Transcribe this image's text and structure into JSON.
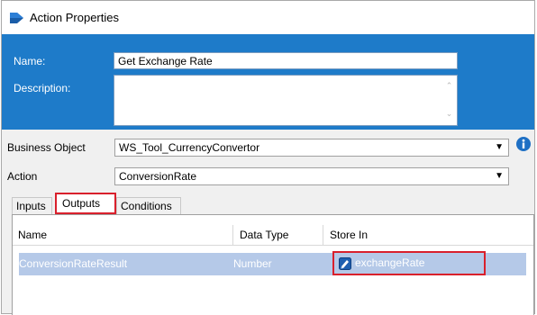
{
  "window": {
    "title": "Action Properties"
  },
  "form": {
    "name_label": "Name:",
    "name_value": "Get Exchange Rate",
    "description_label": "Description:",
    "description_value": "",
    "business_object_label": "Business Object",
    "business_object_value": "WS_Tool_CurrencyConvertor",
    "action_label": "Action",
    "action_value": "ConversionRate"
  },
  "tabs": [
    {
      "label": "Inputs",
      "active": false
    },
    {
      "label": "Outputs",
      "active": true
    },
    {
      "label": "Conditions",
      "active": false
    }
  ],
  "grid": {
    "columns": [
      "Name",
      "Data Type",
      "Store In"
    ],
    "rows": [
      {
        "name": "ConversionRateResult",
        "data_type": "Number",
        "store_in": "exchangeRate",
        "selected": true
      }
    ]
  },
  "icons": {
    "app": "action-diamond-icon",
    "info": "info-icon",
    "data_item": "data-item-icon"
  },
  "colors": {
    "header_blue": "#1e7bc9",
    "highlight_red": "#d9202c",
    "selected_row": "#b5c9e8"
  }
}
